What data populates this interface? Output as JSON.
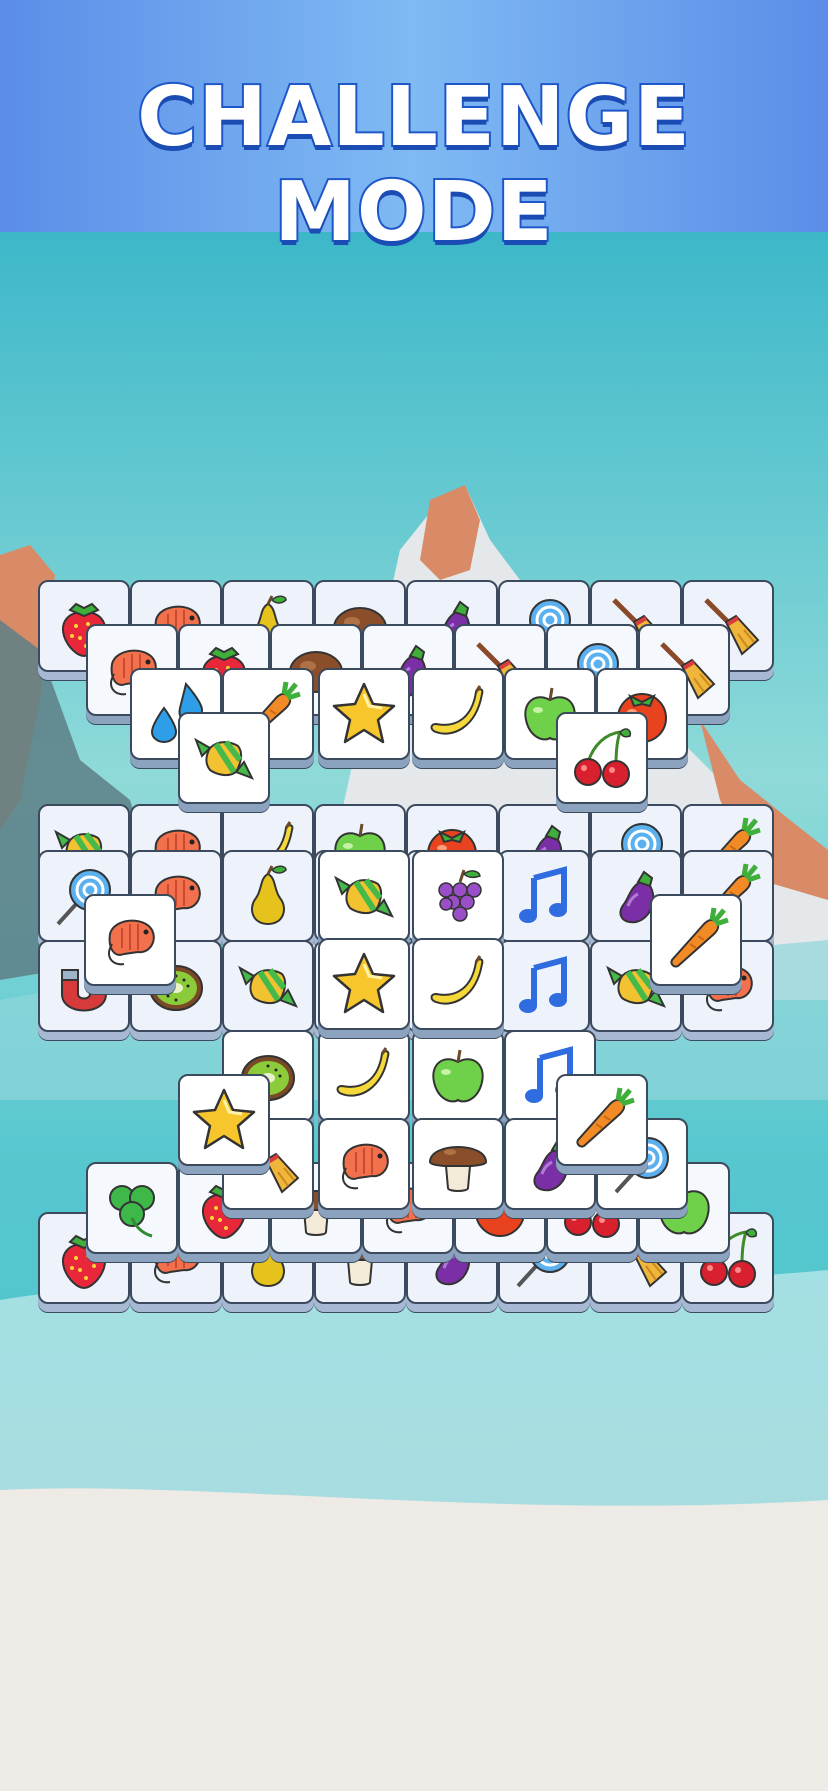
{
  "header": {
    "title": "CHALLENGE MODE"
  },
  "colors": {
    "banner": "#6ea3ee",
    "sky": "#4cc3cf",
    "snow": "#eeeae6",
    "title_stroke": "#1e57c9"
  },
  "board": {
    "layers": [
      {
        "level": 0,
        "rows": [
          [
            "strawberry-icon",
            "shrimp-icon",
            "pear-icon",
            "coconut-icon",
            "eggplant-icon",
            "lollipop-icon",
            "broom-icon",
            "broom-icon"
          ],
          [
            "candy-icon",
            "shrimp-icon",
            "banana-icon",
            "apple-icon",
            "tomato-icon",
            "eggplant-icon",
            "lollipop-icon",
            "carrot-icon"
          ],
          [
            "lollipop-icon",
            "shrimp-icon",
            "pear-icon",
            "candy-icon",
            "grapes-icon",
            "music-note-icon",
            "eggplant-icon",
            "carrot-icon"
          ],
          [
            "magnet-icon",
            "kiwi-icon",
            "candy-icon",
            "star-icon",
            "banana-icon",
            "music-note-icon",
            "candy-icon",
            "shrimp-icon"
          ],
          [
            "strawberry-icon",
            "shrimp-icon",
            "pear-icon",
            "mushroom-icon",
            "eggplant-icon",
            "lollipop-icon",
            "broom-icon",
            "cherry-icon"
          ]
        ]
      },
      {
        "level": 1,
        "rows": [
          [
            "shrimp-icon",
            "strawberry-icon",
            "coconut-icon",
            "eggplant-icon",
            "broom-icon",
            "lollipop-icon",
            "broom-icon"
          ],
          [
            "clover-icon",
            "strawberry-icon",
            "mushroom-icon",
            "shrimp-icon",
            "tomato-icon",
            "cherry-icon",
            "apple-icon"
          ]
        ]
      },
      {
        "level": 2,
        "rows": [
          [
            "water-drop-icon",
            "carrot-icon",
            "star-icon",
            "banana-icon",
            "apple-icon",
            "tomato-icon"
          ],
          [
            "kiwi-icon",
            "banana-icon",
            "apple-icon",
            "music-note-icon"
          ],
          [
            "broom-icon",
            "shrimp-icon",
            "mushroom-icon",
            "eggplant-icon",
            "lollipop-icon"
          ]
        ]
      },
      {
        "level": 3,
        "rows": [
          [
            "candy-icon",
            "cherry-icon"
          ],
          [
            "shrimp-icon",
            "candy-icon",
            "grapes-icon",
            "carrot-icon"
          ],
          [
            "star-icon",
            "banana-icon"
          ],
          [
            "star-icon",
            "carrot-icon"
          ]
        ]
      }
    ]
  }
}
